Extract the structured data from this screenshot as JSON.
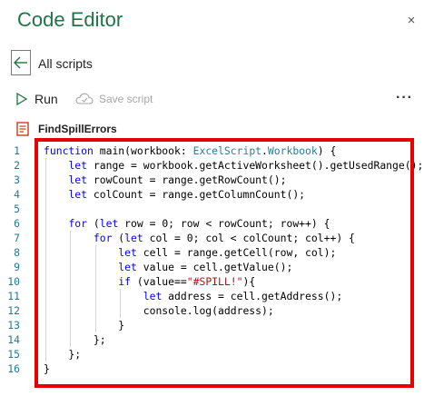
{
  "header": {
    "title": "Code Editor",
    "close_glyph": "×"
  },
  "nav": {
    "back_label": "All scripts"
  },
  "toolbar": {
    "run_label": "Run",
    "save_label": "Save script",
    "more_glyph": "···"
  },
  "script": {
    "name": "FindSpillErrors"
  },
  "editor": {
    "line_numbers": [
      "1",
      "2",
      "3",
      "4",
      "5",
      "6",
      "7",
      "8",
      "9",
      "10",
      "11",
      "12",
      "13",
      "14",
      "15",
      "16"
    ],
    "lines": [
      "function main(workbook: ExcelScript.Workbook) {",
      "    let range = workbook.getActiveWorksheet().getUsedRange();",
      "    let rowCount = range.getRowCount();",
      "    let colCount = range.getColumnCount();",
      "",
      "    for (let row = 0; row < rowCount; row++) {",
      "        for (let col = 0; col < colCount; col++) {",
      "            let cell = range.getCell(row, col);",
      "            let value = cell.getValue();",
      "            if (value==\"#SPILL!\"){",
      "                let address = cell.getAddress();",
      "                console.log(address);",
      "            }",
      "        };",
      "    };",
      "}"
    ]
  },
  "colors": {
    "brand": "#217346",
    "keyword": "#0000ff",
    "type": "#267f99",
    "string": "#a31515",
    "line_number": "#237893",
    "highlight_border": "#e60000"
  },
  "icons": [
    "close-icon",
    "back-arrow-icon",
    "play-icon",
    "cloud-save-icon",
    "more-icon",
    "script-file-icon"
  ]
}
